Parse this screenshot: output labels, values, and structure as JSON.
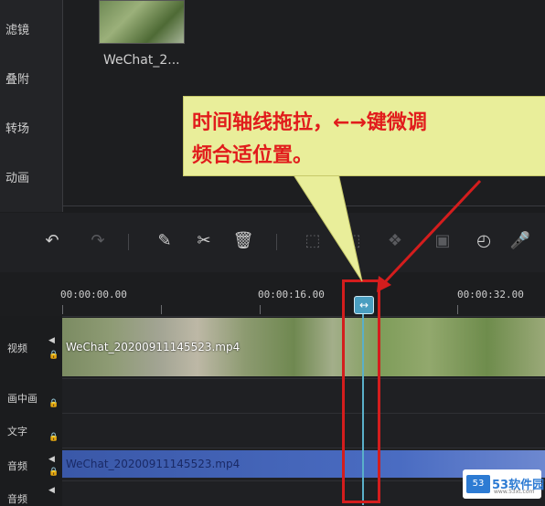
{
  "sidebar": {
    "items": [
      {
        "label": "滤镜"
      },
      {
        "label": "叠附"
      },
      {
        "label": "转场"
      },
      {
        "label": "动画"
      }
    ]
  },
  "media": {
    "clip_name": "WeChat_2..."
  },
  "toolbar": {
    "icons": [
      "undo-icon",
      "redo-icon",
      "edit-icon",
      "cut-icon",
      "delete-icon",
      "crop-icon",
      "crop-zoom-icon",
      "mosaic-icon",
      "freeze-icon",
      "speed-icon",
      "mic-icon"
    ]
  },
  "ruler": {
    "labels": [
      "00:00:00.00",
      "00:00:16.00",
      "00:00:32.00"
    ]
  },
  "tracks": {
    "video": {
      "label": "视频"
    },
    "pip": {
      "label": "画中画"
    },
    "text": {
      "label": "文字"
    },
    "audio": {
      "label": "音频"
    },
    "audio2": {
      "label": "音频"
    }
  },
  "clips": {
    "video_name": "WeChat_20200911145523.mp4",
    "audio_name": "WeChat_20200911145523.mp4"
  },
  "callout": {
    "line1": "时间轴线拖拉，←→键微调",
    "line2": "频合适位置。"
  },
  "watermark": {
    "logo": "53",
    "text": "53软件园",
    "sub": "www.53xt.com"
  },
  "colors": {
    "callout_bg": "#e9ee9a",
    "callout_text": "#e11c1c",
    "highlight": "#d41d1d",
    "playhead": "#5ab0c9",
    "audio_clip": "#4a6cc2"
  }
}
